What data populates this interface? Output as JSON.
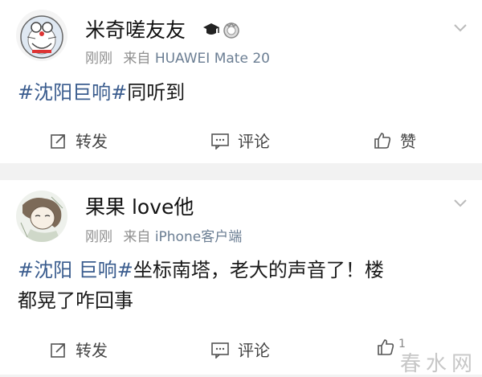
{
  "posts": [
    {
      "username": "米奇嗟友友",
      "time": "刚刚",
      "source_prefix": "来自",
      "source": "HUAWEI Mate 20",
      "text_tag": "#沈阳巨响#",
      "text_rest": "同听到",
      "actions": {
        "repost": "转发",
        "comment": "评论",
        "like": "赞"
      }
    },
    {
      "username": "果果 love他",
      "time": "刚刚",
      "source_prefix": "来自",
      "source": "iPhone客户端",
      "text_tag": "#沈阳 巨响#",
      "text_line1_rest": "坐标南塔，老大的声音了！楼",
      "text_line2": "都晃了咋回事",
      "actions": {
        "repost": "转发",
        "comment": "评论",
        "like": "1"
      }
    }
  ],
  "watermark": "春水网",
  "colors": {
    "topic": "#3a5c8e",
    "meta": "#8f8f8f",
    "separator": "#f2f2f2"
  }
}
